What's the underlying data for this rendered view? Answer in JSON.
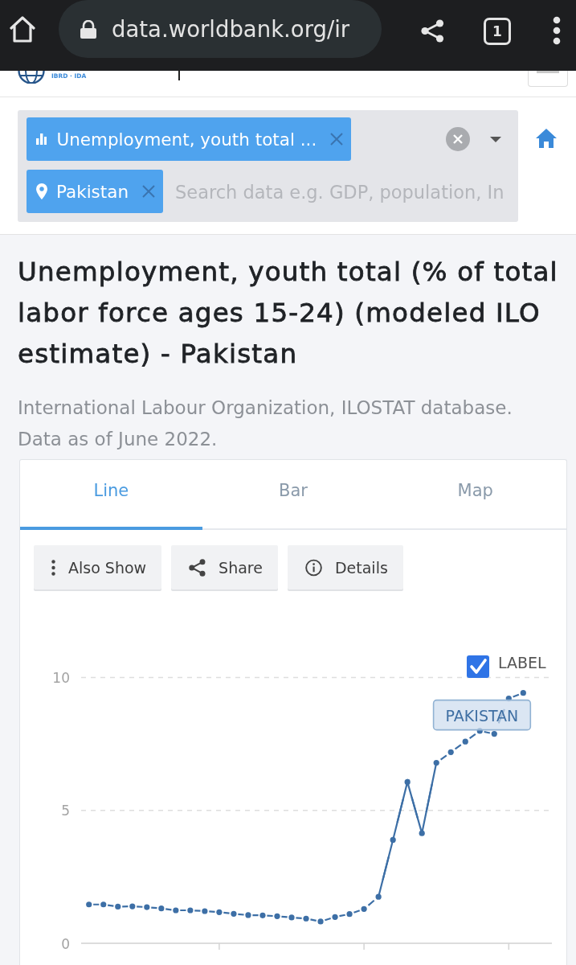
{
  "browser_bar": {
    "url": "data.worldbank.org/ir",
    "tab_count": "1"
  },
  "site_header": {
    "logo_subtitle": "IBRD · IDA"
  },
  "search": {
    "chips": [
      {
        "kind": "indicator",
        "label": "Unemployment, youth total ..."
      },
      {
        "kind": "country",
        "label": "Pakistan"
      }
    ],
    "placeholder": "Search data e.g. GDP, population, In"
  },
  "title": "Unemployment, youth total (% of total labor force ages 15-24) (modeled ILO estimate) - Pakistan",
  "source": "International Labour Organization, ILOSTAT database. Data as of June 2022.",
  "tabs": [
    {
      "label": "Line",
      "selected": true
    },
    {
      "label": "Bar",
      "selected": false
    },
    {
      "label": "Map",
      "selected": false
    }
  ],
  "actions": [
    {
      "kind": "more",
      "label": "Also Show"
    },
    {
      "kind": "share",
      "label": "Share"
    },
    {
      "kind": "info",
      "label": "Details"
    }
  ],
  "chart": {
    "label_toggle": {
      "label": "LABEL",
      "checked": true
    },
    "chart_data": {
      "type": "line",
      "ylim": [
        0,
        10
      ],
      "yticks": [
        0,
        5,
        10
      ],
      "series": [
        {
          "name": "PAKISTAN",
          "color": "#3d6fa6",
          "line_style": "dashed",
          "marker": "circle",
          "values": [
            1.46,
            1.46,
            1.38,
            1.39,
            1.36,
            1.31,
            1.24,
            1.24,
            1.21,
            1.17,
            1.11,
            1.06,
            1.05,
            1.02,
            0.97,
            0.93,
            0.82,
            0.99,
            1.1,
            1.29,
            1.75,
            3.89,
            6.07,
            4.14,
            6.79,
            7.19,
            7.59,
            7.99,
            7.88,
            9.21,
            9.42
          ]
        },
        {
          "color": "#3d6fa6",
          "line_style": "solid",
          "values": [
            null,
            null,
            null,
            null,
            null,
            null,
            null,
            null,
            null,
            null,
            null,
            null,
            null,
            null,
            null,
            null,
            null,
            null,
            null,
            null,
            1.75,
            3.89,
            6.07,
            4.14,
            6.79,
            null,
            null,
            null,
            null,
            null,
            null
          ]
        }
      ]
    }
  }
}
